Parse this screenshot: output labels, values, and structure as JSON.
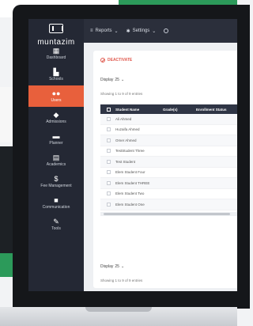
{
  "app": {
    "logo_text": "muntazim"
  },
  "topbar": {
    "menus": [
      {
        "label": "Reports",
        "icon": "bars-icon"
      },
      {
        "label": "Settings",
        "icon": "gear-icon"
      }
    ]
  },
  "sidebar": {
    "items": [
      {
        "label": "Dashboard",
        "icon": "grid-icon",
        "active": false
      },
      {
        "label": "Schools",
        "icon": "building-icon",
        "active": false
      },
      {
        "label": "Users",
        "icon": "users-icon",
        "active": true
      },
      {
        "label": "Admissions",
        "icon": "graduation-cap-icon",
        "active": false
      },
      {
        "label": "Planner",
        "icon": "book-icon",
        "active": false
      },
      {
        "label": "Academics",
        "icon": "id-card-icon",
        "active": false
      },
      {
        "label": "Fee Management",
        "icon": "dollar-icon",
        "active": false
      },
      {
        "label": "Communication",
        "icon": "chat-icon",
        "active": false
      },
      {
        "label": "Tools",
        "icon": "wrench-icon",
        "active": false
      }
    ]
  },
  "main": {
    "deactivate_label": "DEACTIVATE",
    "display_top": {
      "label": "Display",
      "value": "25"
    },
    "entries_top": "Showing 1 to 9 of 9 entries",
    "table": {
      "headers": [
        "Student Name",
        "Grade(s)",
        "Enrollment Status"
      ],
      "rows": [
        "Ali Ahmed",
        "Huzaifa Ahmed",
        "Omer Ahmed",
        "TestStudent Three",
        "Test Student",
        "Elem Student Four",
        "Elem Student THREE",
        "Elem Student Two",
        "Elem Student One"
      ]
    },
    "display_bottom": {
      "label": "Display",
      "value": "25"
    },
    "entries_bottom": "Showing 1 to 9 of 9 entries"
  },
  "colors": {
    "sidebar_bg": "#242834",
    "active_accent": "#e8603c",
    "table_header_bg": "#2f3545",
    "deactivate_red": "#e05a4f"
  }
}
